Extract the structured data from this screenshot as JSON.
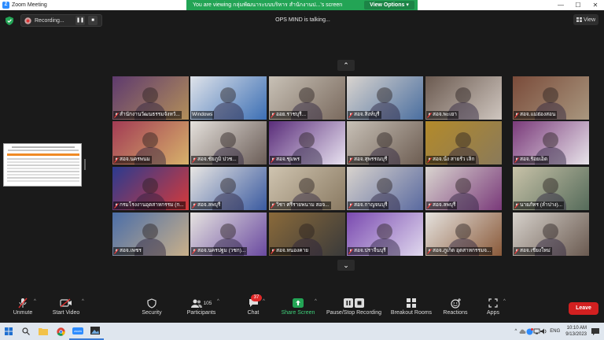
{
  "window": {
    "title": "Zoom Meeting",
    "controls": [
      "—",
      "☐",
      "✕"
    ]
  },
  "banner": {
    "text": "You are viewing กลุ่มพัฒนาระบบบริหาร สำนักงานป...'s screen",
    "options_label": "View Options",
    "options_caret": "▾"
  },
  "recording": {
    "label": "Recording...",
    "pause_symbol": "❚❚",
    "stop_symbol": "■"
  },
  "talking": "OPS MIND is talking...",
  "view_button": {
    "label": "View"
  },
  "paging": {
    "up": "⌃",
    "down": "⌄"
  },
  "tiles": [
    {
      "label": "สำนักงานวัฒนธรรมจังหวั...",
      "muted": true,
      "active": false,
      "c1": "#5e3a6e",
      "c2": "#b38f5a"
    },
    {
      "label": "Windows",
      "muted": false,
      "active": false,
      "c1": "#dfe3ea",
      "c2": "#3c6fb4"
    },
    {
      "label": "ออย.ราชบุรี...",
      "muted": true,
      "active": true,
      "c1": "#c8c1b6",
      "c2": "#7a6a5e"
    },
    {
      "label": "สอจ.สิงห์บุรี",
      "muted": true,
      "active": false,
      "c1": "#d9d4cf",
      "c2": "#4b6fa0"
    },
    {
      "label": "สอจ.พะเยา",
      "muted": true,
      "active": false,
      "c1": "#6b5a50",
      "c2": "#cfc6bf"
    },
    {
      "label": "สอจ.แม่ฮ่องสอน",
      "muted": true,
      "active": false,
      "c1": "#7a4b3a",
      "c2": "#a9977f"
    },
    {
      "label": "สอจ.นครพนม",
      "muted": true,
      "active": false,
      "c1": "#a23b54",
      "c2": "#d7b26b"
    },
    {
      "label": "สอจ.ชัยภูมิ ปวช...",
      "muted": true,
      "active": false,
      "c1": "#e5e1dc",
      "c2": "#6a5c56"
    },
    {
      "label": "สอจ.ชุมพร",
      "muted": true,
      "active": false,
      "c1": "#5a2d7a",
      "c2": "#e8e2f0"
    },
    {
      "label": "สอจ.สุพรรณบุรี",
      "muted": true,
      "active": false,
      "c1": "#c7c0b6",
      "c2": "#6d5d52"
    },
    {
      "label": "สอจ.นั้ง สายรั่ว เลิก",
      "muted": true,
      "active": false,
      "c1": "#b38a2a",
      "c2": "#8a7a5a"
    },
    {
      "label": "สอจ.ร้อยเอ็ด",
      "muted": true,
      "active": false,
      "c1": "#7a3a7a",
      "c2": "#e8e4ea"
    },
    {
      "label": "กรมโรงงานอุตสาหกรรม (ก...",
      "muted": true,
      "active": false,
      "c1": "#2b3a8f",
      "c2": "#d63a3a"
    },
    {
      "label": "สอจ.ลพบุรี",
      "muted": true,
      "active": false,
      "c1": "#e8e6e3",
      "c2": "#3a5aa0"
    },
    {
      "label": "วิชา ศรีรายพนาม สอจ...",
      "muted": true,
      "active": false,
      "c1": "#cfc4b0",
      "c2": "#8a7a62"
    },
    {
      "label": "สอจ.กาญจนบุรี",
      "muted": true,
      "active": false,
      "c1": "#d8d3cd",
      "c2": "#5a6aa0"
    },
    {
      "label": "สอจ.ลพบุรี",
      "muted": true,
      "active": false,
      "c1": "#d9d4cf",
      "c2": "#7a3a7a"
    },
    {
      "label": "นายภัทร (ลำปาง)...",
      "muted": true,
      "active": false,
      "c1": "#c8c2a8",
      "c2": "#556b5a"
    },
    {
      "label": "สอจ.เพชร",
      "muted": true,
      "active": false,
      "c1": "#4b6ea8",
      "c2": "#c9b08a"
    },
    {
      "label": "สอจ.นครปฐม (วชก)...",
      "muted": true,
      "active": false,
      "c1": "#e6e3e0",
      "c2": "#6a4aa0"
    },
    {
      "label": "สอจ.หนองคาย",
      "muted": true,
      "active": false,
      "c1": "#8a6a3a",
      "c2": "#3a3a3a"
    },
    {
      "label": "สอจ.ปราจีนบุรี",
      "muted": true,
      "active": false,
      "c1": "#7a4ab0",
      "c2": "#e0d8ee"
    },
    {
      "label": "สอจ.ภูเก็ต อุตสาหกรรมจ...",
      "muted": true,
      "active": false,
      "c1": "#e5e2de",
      "c2": "#8a5a3a"
    },
    {
      "label": "สอจ.เชียงใหม่",
      "muted": true,
      "active": false,
      "c1": "#d6d1cb",
      "c2": "#6a5a50"
    }
  ],
  "toolbar": {
    "unmute": "Unmute",
    "start_video": "Start Video",
    "security": "Security",
    "participants": "Participants",
    "participants_count": "105",
    "chat": "Chat",
    "chat_badge": "37",
    "share_screen": "Share Screen",
    "pause_stop": "Pause/Stop Recording",
    "breakout": "Breakout Rooms",
    "reactions": "Reactions",
    "apps": "Apps",
    "leave": "Leave"
  },
  "taskbar": {
    "zoom_label": "zoom",
    "lang": "ENG",
    "time": "10:10 AM",
    "date": "9/13/2023",
    "tray_caret": "^"
  },
  "colors": {
    "accent_green": "#23a455",
    "leave_red": "#d22020",
    "share_green": "#23a455"
  }
}
